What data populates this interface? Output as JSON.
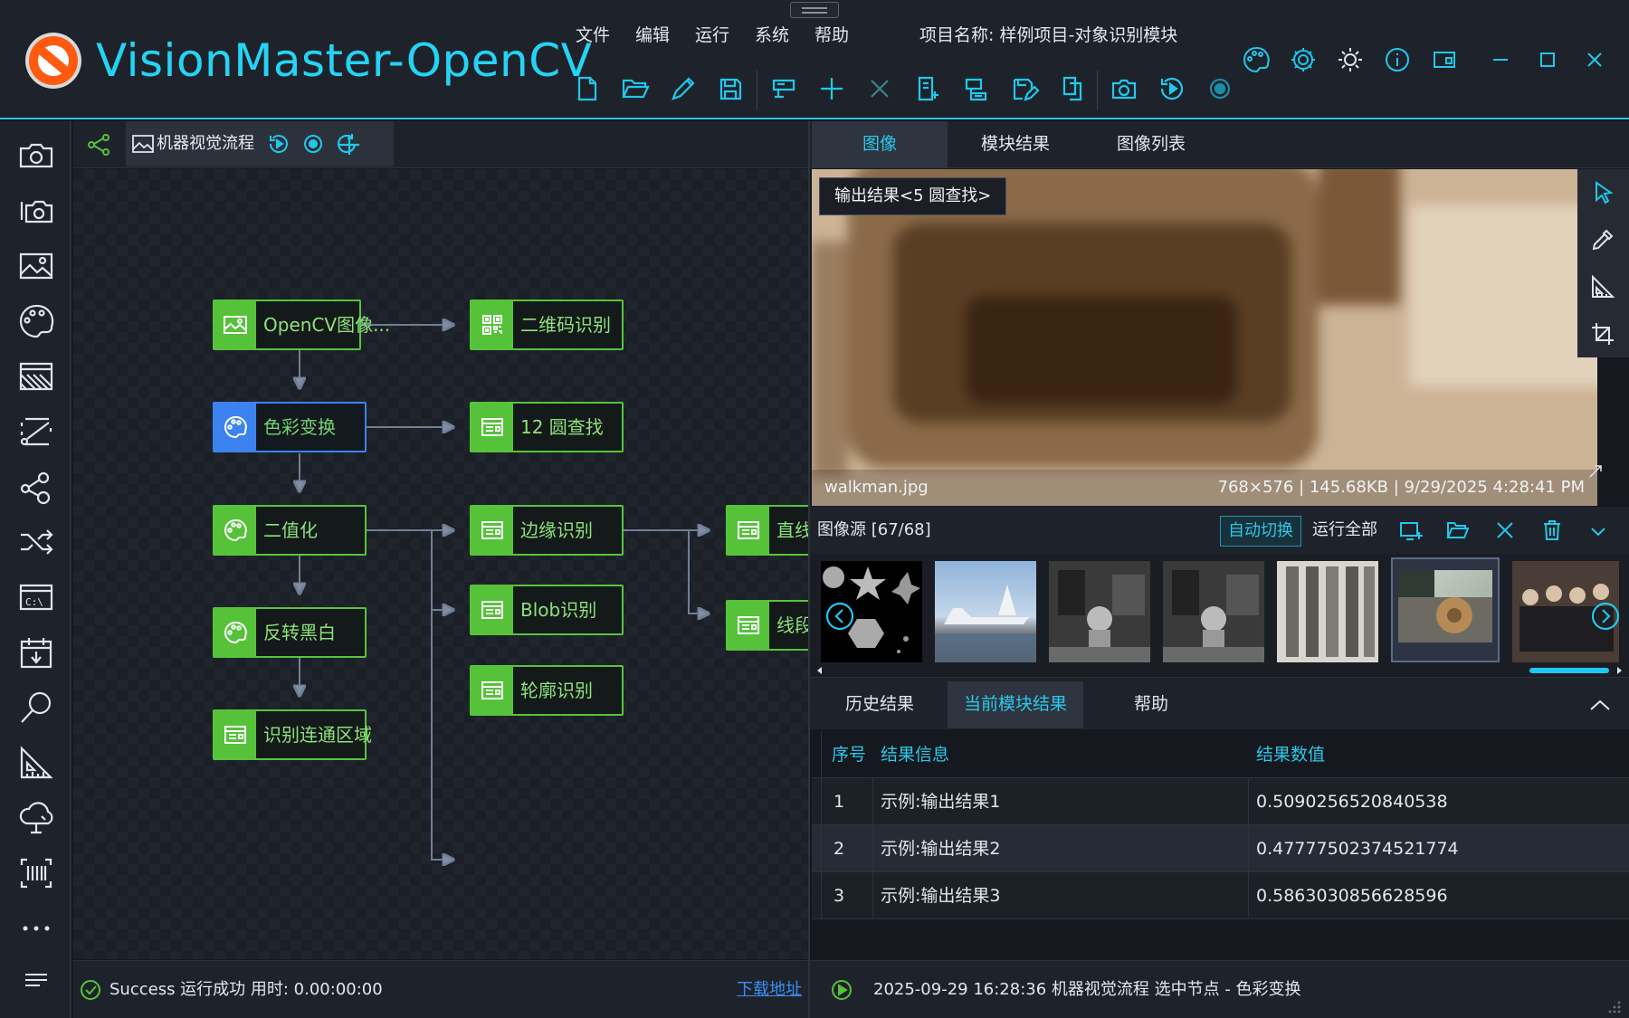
{
  "app": {
    "title": "VisionMaster-OpenCV",
    "menu": [
      "文件",
      "编辑",
      "运行",
      "系统",
      "帮助"
    ],
    "project_label": "项目名称:",
    "project_name": "样例项目-对象识别模块"
  },
  "toolbar": {
    "icons": [
      "new-file-icon",
      "open-folder-icon",
      "edit-icon",
      "save-icon",
      "device-icon",
      "add-icon",
      "delete-icon",
      "add-document-icon",
      "layers-icon",
      "save-as-icon",
      "copy-icon",
      "camera-icon",
      "run-once-icon",
      "record-icon"
    ]
  },
  "window_controls": [
    "palette-icon",
    "settings-icon",
    "theme-icon",
    "info-icon",
    "layout-icon",
    "minimize-icon",
    "maximize-icon",
    "close-icon"
  ],
  "left_bar": {
    "icons": [
      "camera-icon",
      "multi-camera-icon",
      "image-icon",
      "color-palette-icon",
      "filter-icon",
      "cut-measure-icon",
      "graph-icon",
      "shuffle-icon",
      "terminal-icon",
      "calendar-icon",
      "search-icon",
      "ruler-icon",
      "cloud-icon",
      "barcode-scan-icon",
      "more-icon",
      "menu-icon"
    ]
  },
  "flow": {
    "tab_label": "机器视觉流程",
    "nodes": [
      {
        "id": "n1",
        "label": "OpenCV图像...",
        "icon": "image-icon",
        "selected": false
      },
      {
        "id": "n2",
        "label": "二维码识别",
        "icon": "qr-code-icon",
        "selected": false
      },
      {
        "id": "n3",
        "label": "色彩变换",
        "icon": "palette-icon",
        "selected": true
      },
      {
        "id": "n4",
        "label": "12 圆查找",
        "icon": "module-icon",
        "selected": false
      },
      {
        "id": "n5",
        "label": "二值化",
        "icon": "palette-icon",
        "selected": false
      },
      {
        "id": "n6",
        "label": "边缘识别",
        "icon": "module-icon",
        "selected": false
      },
      {
        "id": "n7",
        "label": "直线",
        "icon": "module-icon",
        "selected": false
      },
      {
        "id": "n8",
        "label": "Blob识别",
        "icon": "module-icon",
        "selected": false
      },
      {
        "id": "n9",
        "label": "线段",
        "icon": "module-icon",
        "selected": false
      },
      {
        "id": "n10",
        "label": "反转黑白",
        "icon": "palette-icon",
        "selected": false
      },
      {
        "id": "n11",
        "label": "轮廓识别",
        "icon": "module-icon",
        "selected": false
      },
      {
        "id": "n12",
        "label": "识别连通区域",
        "icon": "module-icon",
        "selected": false
      }
    ],
    "status": "Success 运行成功 用时: 0.00:00:00",
    "download_link": "下载地址"
  },
  "right": {
    "tabs": [
      "图像",
      "模块结果",
      "图像列表"
    ],
    "tooltip": "输出结果<5 圆查找>",
    "image": {
      "filename": "walkman.jpg",
      "info": "768×576 | 145.68KB | 9/29/2025 4:28:41 PM"
    },
    "source": {
      "label": "图像源 [67/68]",
      "auto_switch": "自动切换",
      "run_all": "运行全部"
    },
    "bottom_tabs": [
      "历史结果",
      "当前模块结果",
      "帮助"
    ],
    "table": {
      "headers": [
        "序号",
        "结果信息",
        "结果数值"
      ],
      "rows": [
        [
          "1",
          "示例:输出结果1",
          "0.5090256520840538"
        ],
        [
          "2",
          "示例:输出结果2",
          "0.47777502374521774"
        ],
        [
          "3",
          "示例:输出结果3",
          "0.5863030856628596"
        ]
      ]
    },
    "status": "2025-09-29 16:28:36 机器视觉流程 选中节点 - 色彩变换"
  },
  "colors": {
    "accent": "#24d4f4",
    "node_green": "#55c23a",
    "node_selected": "#3d83f0",
    "bg": "#15191f",
    "panel": "#1e232b"
  }
}
